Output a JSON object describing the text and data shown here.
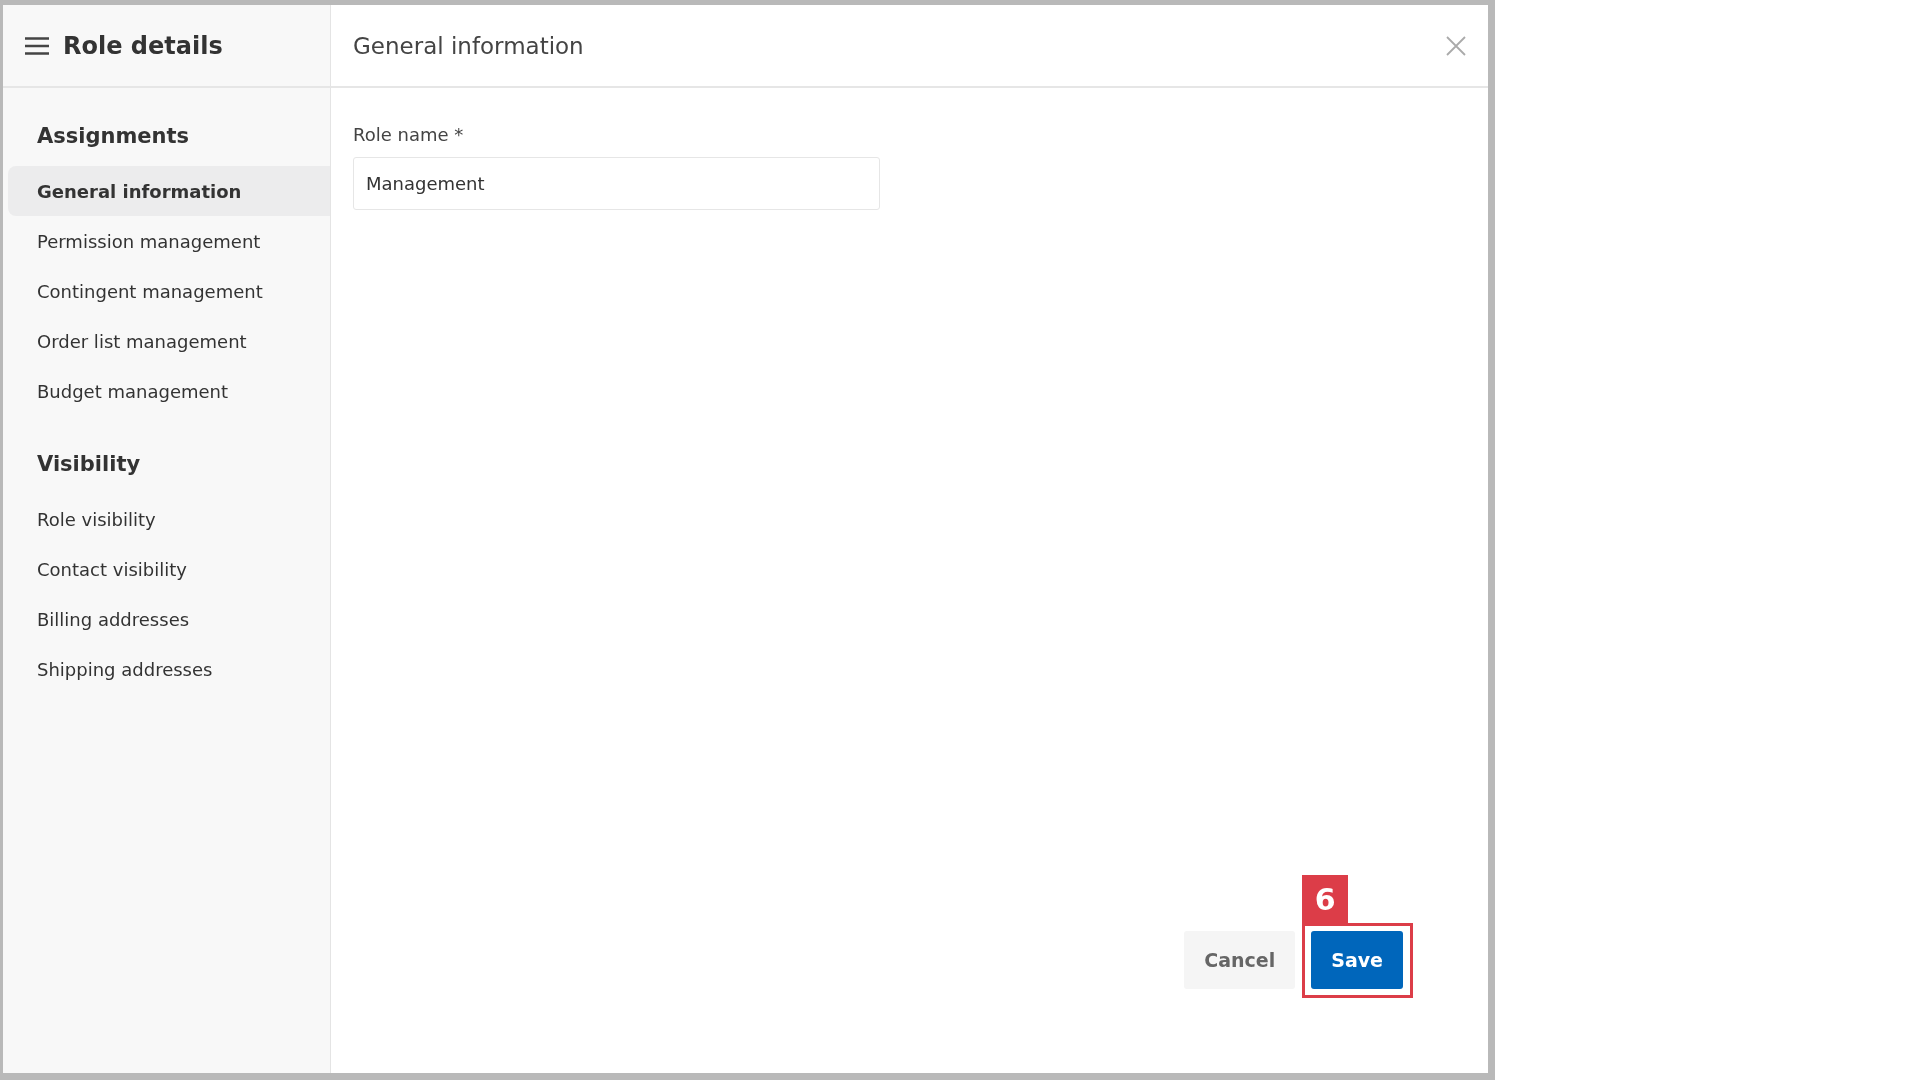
{
  "sidebar": {
    "title": "Role details",
    "sections": [
      {
        "heading": "Assignments",
        "items": [
          {
            "label": "General information",
            "selected": true
          },
          {
            "label": "Permission management",
            "selected": false
          },
          {
            "label": "Contingent management",
            "selected": false
          },
          {
            "label": "Order list management",
            "selected": false
          },
          {
            "label": "Budget management",
            "selected": false
          }
        ]
      },
      {
        "heading": "Visibility",
        "items": [
          {
            "label": "Role visibility",
            "selected": false
          },
          {
            "label": "Contact visibility",
            "selected": false
          },
          {
            "label": "Billing addresses",
            "selected": false
          },
          {
            "label": "Shipping addresses",
            "selected": false
          }
        ]
      }
    ]
  },
  "main": {
    "title": "General information",
    "field": {
      "label": "Role name *",
      "value": "Management"
    }
  },
  "buttons": [
    {
      "kind": "secondary",
      "label": "Cancel"
    },
    {
      "kind": "primary",
      "label": "Save",
      "callout": "6"
    }
  ]
}
